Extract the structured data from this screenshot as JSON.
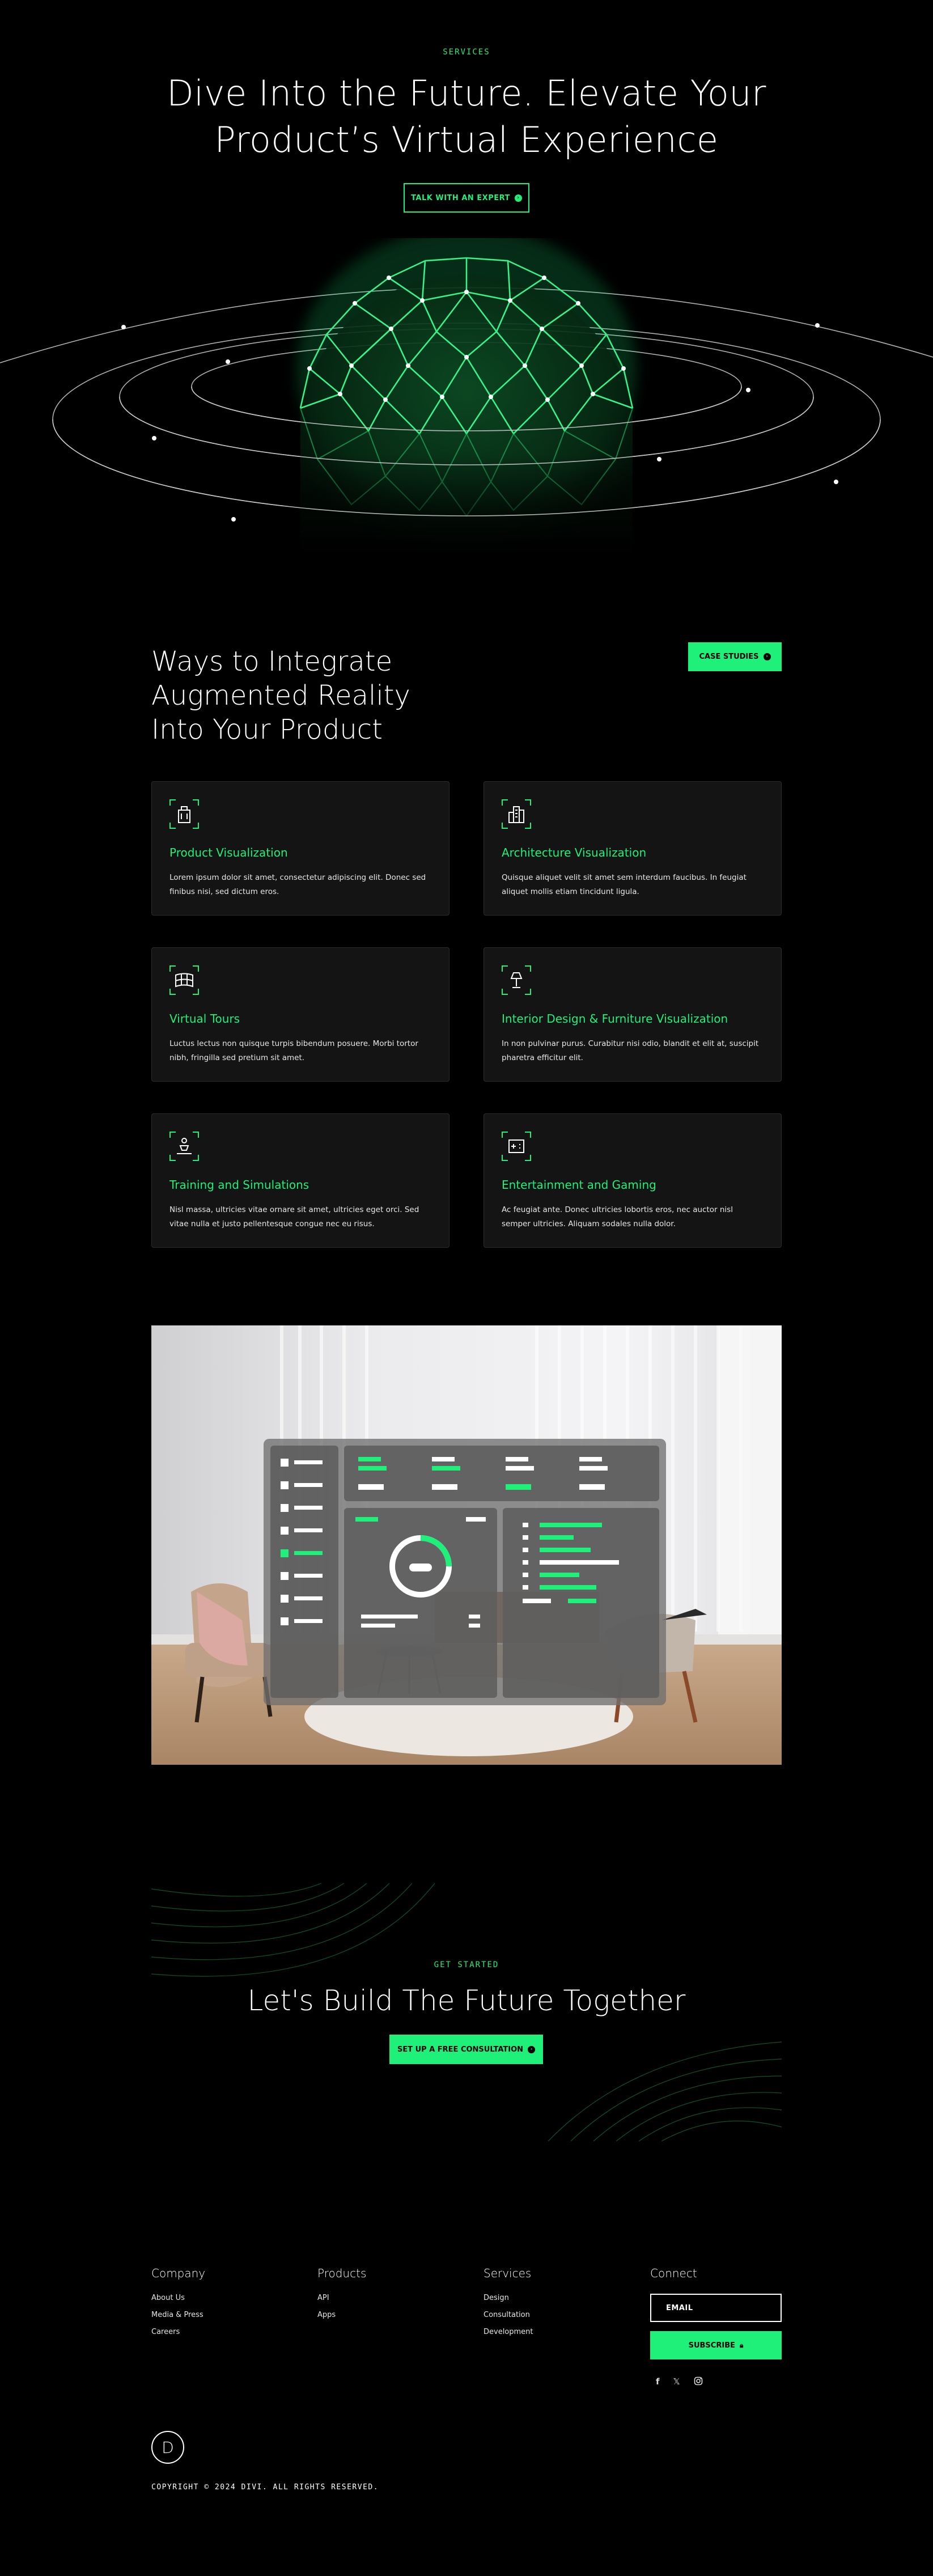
{
  "colors": {
    "accent": "#1ef07a",
    "background": "#000000",
    "card": "#141414"
  },
  "hero": {
    "eyebrow": "SERVICES",
    "title_line1": "Dive Into the Future. Elevate Your",
    "title_line2": "Product’s Virtual Experience",
    "cta_label": "TALK WITH AN EXPERT"
  },
  "ar": {
    "title_line1": "Ways to Integrate",
    "title_line2": "Augmented Reality",
    "title_line3": "Into Your Product",
    "button_label": "CASE STUDIES",
    "cards": [
      {
        "title": "Product Visualization",
        "text": "Lorem ipsum dolor sit amet, consectetur adipiscing elit. Donec sed finibus nisi, sed dictum eros.",
        "icon": "product-icon"
      },
      {
        "title": "Architecture Visualization",
        "text": "Quisque aliquet velit sit amet sem interdum faucibus. In feugiat aliquet mollis etiam tincidunt ligula.",
        "icon": "buildings-icon"
      },
      {
        "title": "Virtual Tours",
        "text": "Luctus lectus non quisque turpis bibendum posuere. Morbi tortor nibh, fringilla sed pretium sit amet.",
        "icon": "panorama-icon"
      },
      {
        "title": "Interior Design & Furniture Visualization",
        "text": "In non pulvinar purus. Curabitur nisi odio, blandit et elit at, suscipit pharetra efficitur elit.",
        "icon": "lamp-icon"
      },
      {
        "title": "Training and Simulations",
        "text": "Nisl massa, ultricies vitae ornare sit amet, ultricies eget orci. Sed vitae nulla et justo pellentesque congue nec eu risus.",
        "icon": "trainer-icon"
      },
      {
        "title": "Entertainment and Gaming",
        "text": "Ac feugiat ante. Donec ultricies lobortis eros, nec auctor nisl semper ultricies. Aliquam sodales nulla dolor.",
        "icon": "gamepad-icon"
      }
    ]
  },
  "cta": {
    "eyebrow": "GET STARTED",
    "title": "Let's Build The Future Together",
    "button_label": "SET UP A FREE CONSULTATION"
  },
  "footer": {
    "columns": [
      {
        "heading": "Company",
        "links": [
          "About Us",
          "Media & Press",
          "Careers"
        ]
      },
      {
        "heading": "Products",
        "links": [
          "API",
          "Apps"
        ]
      },
      {
        "heading": "Services",
        "links": [
          "Design",
          "Consultation",
          "Development"
        ]
      }
    ],
    "connect_heading": "Connect",
    "email_placeholder": "EMAIL",
    "subscribe_label": "SUBSCRIBE",
    "social": [
      "facebook-icon",
      "x-icon",
      "instagram-icon"
    ],
    "logo_letter": "D",
    "copyright": "COPYRIGHT © 2024 DIVI. ALL RIGHTS RESERVED."
  }
}
